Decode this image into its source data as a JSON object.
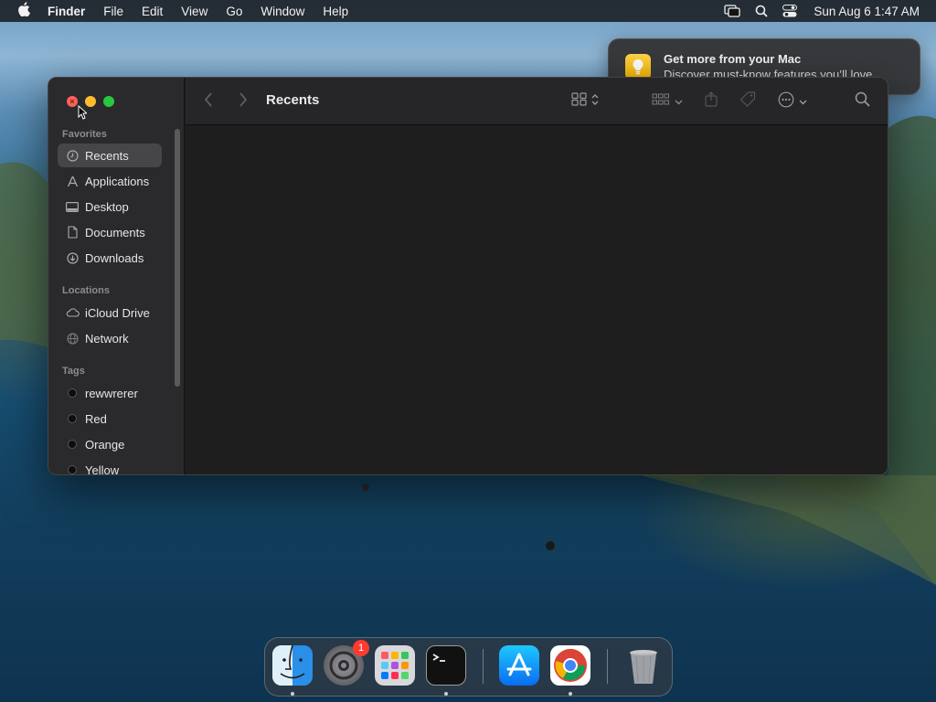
{
  "menubar": {
    "apple_icon": "apple-logo-icon",
    "app_name": "Finder",
    "menus": [
      "File",
      "Edit",
      "View",
      "Go",
      "Window",
      "Help"
    ],
    "status_icons": [
      "screen-mirroring-icon",
      "spotlight-search-icon",
      "control-center-icon"
    ],
    "clock": "Sun Aug 6  1:47 AM"
  },
  "notification": {
    "icon": "lightbulb-icon",
    "title": "Get more from your Mac",
    "body": "Discover must-know features you’ll love."
  },
  "finder": {
    "title": "Recents",
    "toolbar": {
      "back_icon": "chevron-left-icon",
      "forward_icon": "chevron-right-icon",
      "view_icon": "icon-grid-view-icon",
      "group_icon": "group-by-icon",
      "share_icon": "share-icon",
      "tag_icon": "tag-icon",
      "action_icon": "more-actions-icon",
      "search_icon": "search-icon"
    },
    "sidebar": {
      "favorites_label": "Favorites",
      "favorites": [
        {
          "label": "Recents",
          "icon": "clock-icon",
          "selected": true
        },
        {
          "label": "Applications",
          "icon": "applications-icon"
        },
        {
          "label": "Desktop",
          "icon": "desktop-icon"
        },
        {
          "label": "Documents",
          "icon": "document-icon"
        },
        {
          "label": "Downloads",
          "icon": "download-icon"
        }
      ],
      "locations_label": "Locations",
      "locations": [
        {
          "label": "iCloud Drive",
          "icon": "cloud-icon"
        },
        {
          "label": "Network",
          "icon": "network-icon"
        }
      ],
      "tags_label": "Tags",
      "tags": [
        {
          "label": "rewwrerer"
        },
        {
          "label": "Red"
        },
        {
          "label": "Orange"
        },
        {
          "label": "Yellow"
        }
      ]
    }
  },
  "dock": {
    "apps": [
      {
        "name": "Finder",
        "running": true
      },
      {
        "name": "System Settings",
        "badge": "1"
      },
      {
        "name": "Launchpad"
      },
      {
        "name": "Terminal",
        "running": true
      },
      {
        "name": "App Store"
      },
      {
        "name": "Google Chrome",
        "running": true
      },
      {
        "name": "Trash"
      }
    ]
  },
  "colors": {
    "close": "#ff5f57",
    "minimize": "#febc2e",
    "maximize": "#28c840",
    "badge": "#ff3b30",
    "lightbulb": "#f7b500"
  }
}
